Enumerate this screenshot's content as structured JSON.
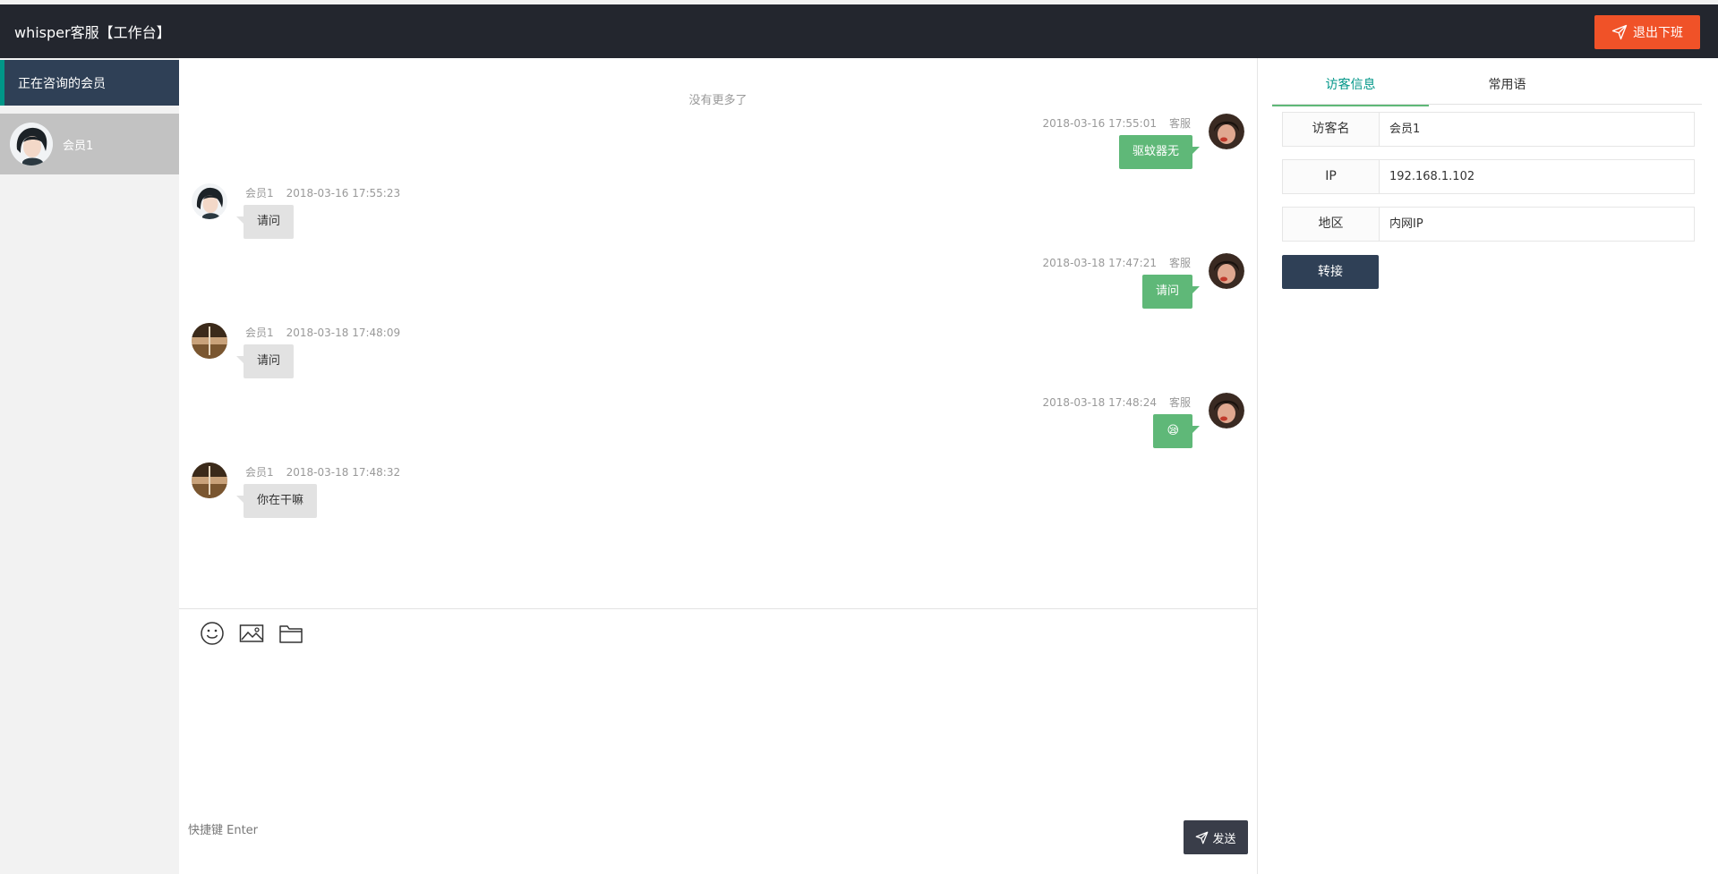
{
  "header": {
    "title": "whisper客服【工作台】",
    "logout_label": "退出下班",
    "logout_color": "#f05228"
  },
  "sidebar": {
    "section_title": "正在咨询的会员",
    "members": [
      {
        "name": "会员1",
        "avatar": "woman-portrait-avatar"
      }
    ]
  },
  "chat": {
    "no_more": "没有更多了",
    "messages": [
      {
        "side": "right",
        "time": "2018-03-16 17:55:01",
        "sender": "客服",
        "text": "驱蚊器无",
        "avatar": "agent-avatar"
      },
      {
        "side": "left",
        "sender": "会员1",
        "time": "2018-03-16 17:55:23",
        "text": "请问",
        "avatar": "woman-portrait-avatar"
      },
      {
        "side": "right",
        "time": "2018-03-18 17:47:21",
        "sender": "客服",
        "text": "请问",
        "avatar": "agent-avatar"
      },
      {
        "side": "left",
        "sender": "会员1",
        "time": "2018-03-18 17:48:09",
        "text": "请问",
        "avatar": "landscape-avatar"
      },
      {
        "side": "right",
        "time": "2018-03-18 17:48:24",
        "sender": "客服",
        "text": "😪",
        "avatar": "agent-avatar"
      },
      {
        "side": "left",
        "sender": "会员1",
        "time": "2018-03-18 17:48:32",
        "text": "你在干嘛",
        "avatar": "landscape-avatar"
      }
    ],
    "bubble_colors": {
      "agent": "#5fb878",
      "visitor": "#e2e2e2"
    }
  },
  "composer": {
    "tools": [
      "emoji-icon",
      "image-icon",
      "folder-icon"
    ],
    "shortcut_hint": "快捷键 Enter",
    "send_label": "发送"
  },
  "panel": {
    "tabs": [
      {
        "label": "访客信息",
        "active": true
      },
      {
        "label": "常用语",
        "active": false
      }
    ],
    "visitor": {
      "name_label": "访客名",
      "name_value": "会员1",
      "ip_label": "IP",
      "ip_value": "192.168.1.102",
      "region_label": "地区",
      "region_value": "内网IP"
    },
    "transfer_label": "转接"
  }
}
